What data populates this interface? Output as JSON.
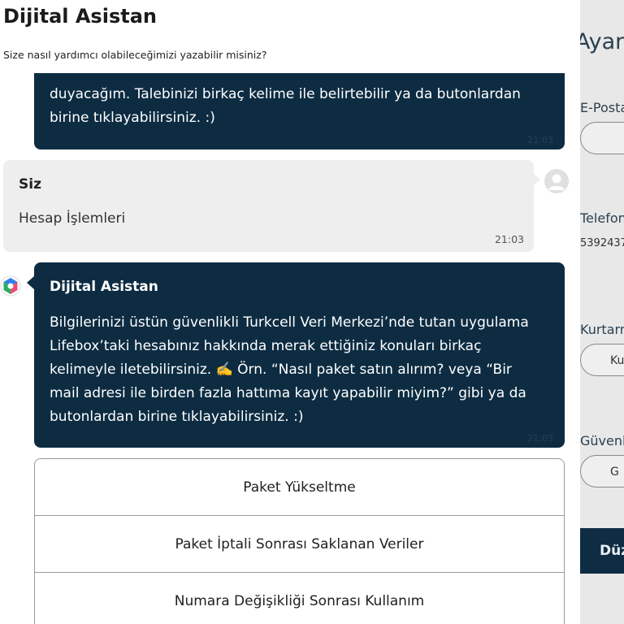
{
  "chat": {
    "title": "Dijital Asistan",
    "subtitle": "Size nasıl yardımcı olabileceğimizi yazabilir misiniz?",
    "messages": {
      "bot_first": {
        "lines": [
          "duyacağım. Talebinizi birkaç kelime ile belirtebilir ya da butonlardan",
          "birine tıklayabilirsiniz. :)"
        ],
        "time": "21:03"
      },
      "user": {
        "sender": "Siz",
        "text": "Hesap İşlemleri",
        "time": "21:03"
      },
      "bot_second": {
        "sender": "Dijital Asistan",
        "lines": [
          "Bilgilerinizi üstün güvenlikli Turkcell Veri Merkezi’nde tutan uygulama",
          "Lifebox’taki hesabınız hakkında merak ettiğiniz konuları birkaç",
          "kelimeyle iletebilirsiniz. ✍️ Örn. “Nasıl paket satın alırım? veya “Bir",
          "mail adresi ile birden fazla hattıma kayıt yapabilir miyim?” gibi ya da",
          "butonlardan birine tıklayabilirsiniz. :)"
        ],
        "time": "21:03"
      }
    },
    "options": [
      "Paket Yükseltme",
      "Paket İptali Sonrası Saklanan Veriler",
      "Numara Değişikliği Sonrası Kullanım"
    ]
  },
  "background_page": {
    "title": "Ayarla",
    "email_label": "E-Posta",
    "phone_label": "Telefon",
    "phone_value": "5392437",
    "recovery_label": "Kurtarma",
    "recovery_button": "Ku",
    "security_label": "Güvenlik",
    "security_button": "G",
    "save_button": "Düz"
  },
  "colors": {
    "bot_bubble": "#0d2c42",
    "user_bubble": "#eeeeee",
    "save_button": "#0e2d44"
  }
}
